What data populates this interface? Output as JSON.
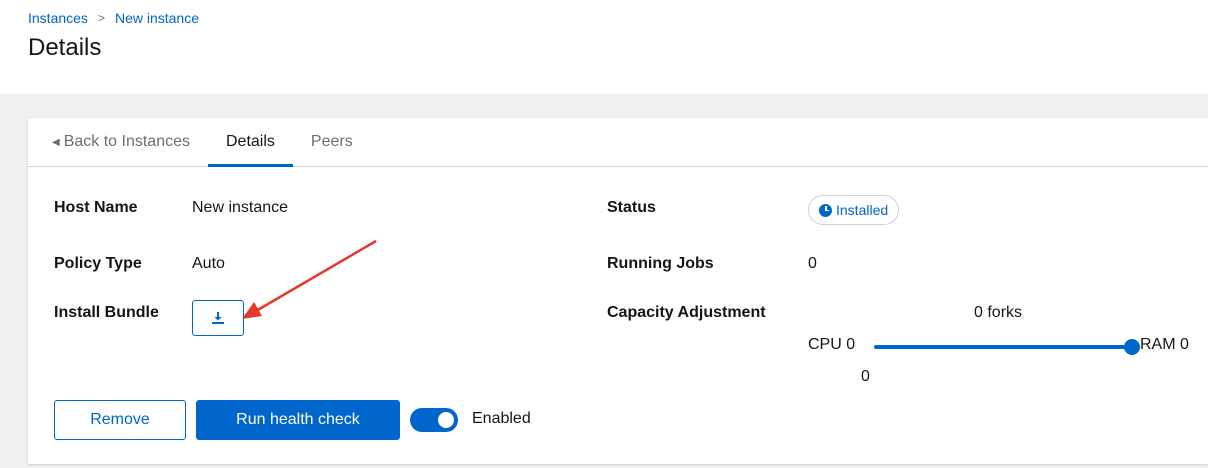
{
  "breadcrumb": {
    "items": [
      "Instances",
      "New instance"
    ],
    "separator": ">"
  },
  "page": {
    "title": "Details"
  },
  "tabs": [
    {
      "label": "Back to Instances",
      "active": false
    },
    {
      "label": "Details",
      "active": true
    },
    {
      "label": "Peers",
      "active": false
    }
  ],
  "details": {
    "host_name": {
      "label": "Host Name",
      "value": "New instance"
    },
    "policy_type": {
      "label": "Policy Type",
      "value": "Auto"
    },
    "install_bundle": {
      "label": "Install Bundle",
      "icon": "download-icon"
    },
    "status": {
      "label": "Status",
      "value": "Installed",
      "icon": "clock-icon"
    },
    "running_jobs": {
      "label": "Running Jobs",
      "value": "0"
    },
    "capacity": {
      "label": "Capacity Adjustment",
      "forks": "0 forks",
      "cpu": "CPU 0",
      "ram": "RAM 0",
      "value": "0",
      "slider_fraction": 1.0
    }
  },
  "actions": {
    "remove_label": "Remove",
    "health_check_label": "Run health check",
    "enabled_label": "Enabled",
    "enabled": true
  },
  "colors": {
    "accent": "#0066cc",
    "annotation_arrow": "#e8382c"
  }
}
